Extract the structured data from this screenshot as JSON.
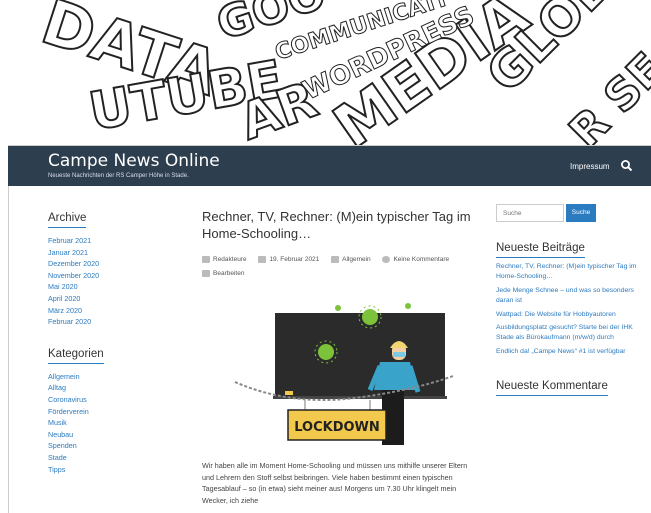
{
  "header": {
    "site_title": "Campe News Online",
    "site_description": "Neueste Nachrichten der RS Camper Höhe in Stade.",
    "nav_impressum": "Impressum",
    "search_icon": "search-icon"
  },
  "banner": {
    "words": [
      "DATA",
      "GOO",
      "COMMUNICATI",
      "UTUBE",
      "WORDPRESS",
      "AR",
      "MEDIA",
      "GLOB",
      "R SE"
    ]
  },
  "sidebar_left": {
    "archive_title": "Archive",
    "archive_items": [
      "Februar 2021",
      "Januar 2021",
      "Dezember 2020",
      "November 2020",
      "Mai 2020",
      "April 2020",
      "März 2020",
      "Februar 2020"
    ],
    "categories_title": "Kategorien",
    "category_items": [
      "Allgemein",
      "Alltag",
      "Coronavirus",
      "Förderverein",
      "Musik",
      "Neubau",
      "Spenden",
      "Stade",
      "Tipps"
    ]
  },
  "post": {
    "title": "Rechner, TV, Rechner: (M)ein typischer Tag im Home-Schooling…",
    "author": "Redakteure",
    "date": "19. Februar 2021",
    "category": "Allgemein",
    "comments": "Keine Kommentare",
    "edit": "Bearbeiten",
    "image_sign": "LOCKDOWN",
    "excerpt": "Wir haben alle im Moment Home-Schooling und müssen uns mithilfe unserer Eltern und Lehrern den Stoff selbst beibringen. Viele haben bestimmt einen typischen Tagesablauf – so (in etwa) sieht meiner aus! Morgens um 7.30 Uhr klingelt mein Wecker, ich ziehe"
  },
  "sidebar_right": {
    "search_placeholder": "Suche",
    "search_button": "Suche",
    "recent_posts_title": "Neueste Beiträge",
    "recent_posts": [
      "Rechner, TV, Rechner: (M)ein typischer Tag im Home-Schooling…",
      "Jede Menge Schnee – und was so besonders daran ist",
      "Wattpad: Die Website für Hobbyautoren",
      "Ausbildungsplatz gesucht? Starte bei der IHK Stade als Bürokaufmann (m/w/d) durch",
      "Endlich da! „Campe News“ #1 ist verfügbar"
    ],
    "recent_comments_title": "Neueste Kommentare"
  },
  "colors": {
    "header_bg": "#2d3e4e",
    "link": "#2b7bc0",
    "chalkboard": "#2b2b2b",
    "virus": "#7cc23b",
    "sign": "#f2c94c"
  }
}
